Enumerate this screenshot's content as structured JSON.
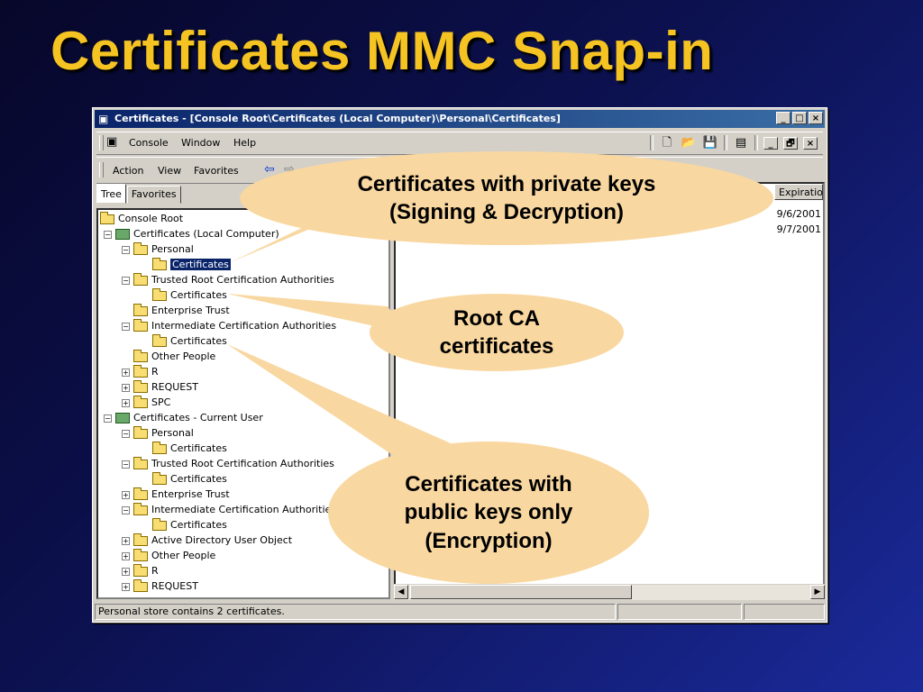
{
  "slide": {
    "title": "Certificates MMC Snap-in"
  },
  "window": {
    "title": "Certificates - [Console Root\\Certificates (Local Computer)\\Personal\\Certificates]",
    "controls": [
      "_",
      "□",
      "×"
    ]
  },
  "menubar": {
    "items": [
      "Console",
      "Window",
      "Help"
    ],
    "mdi_controls": [
      "_",
      "🗗",
      "×"
    ]
  },
  "actionbar": {
    "items": [
      "Action",
      "View",
      "Favorites"
    ]
  },
  "tabs": [
    "Tree",
    "Favorites"
  ],
  "tree": [
    {
      "label": "Console Root"
    },
    {
      "label": "Certificates (Local Computer)"
    },
    {
      "label": "Personal"
    },
    {
      "label": "Certificates"
    },
    {
      "label": "Trusted Root Certification Authorities"
    },
    {
      "label": "Certificates"
    },
    {
      "label": "Enterprise Trust"
    },
    {
      "label": "Intermediate Certification Authorities"
    },
    {
      "label": "Certificates"
    },
    {
      "label": "Other People"
    },
    {
      "label": "R"
    },
    {
      "label": "REQUEST"
    },
    {
      "label": "SPC"
    },
    {
      "label": "Certificates - Current User"
    },
    {
      "label": "Personal"
    },
    {
      "label": "Certificates"
    },
    {
      "label": "Trusted Root Certification Authorities"
    },
    {
      "label": "Certificates"
    },
    {
      "label": "Enterprise Trust"
    },
    {
      "label": "Intermediate Certification Authorities"
    },
    {
      "label": "Certificates"
    },
    {
      "label": "Active Directory User Object"
    },
    {
      "label": "Other People"
    },
    {
      "label": "R"
    },
    {
      "label": "REQUEST"
    }
  ],
  "list": {
    "column": "Expiratio",
    "values": [
      "9/6/2001",
      "9/7/2001"
    ]
  },
  "status": {
    "text": "Personal store contains 2 certificates."
  },
  "callouts": {
    "private": {
      "line1": "Certificates with private keys",
      "line2": "(Signing & Decryption)"
    },
    "root": {
      "line1": "Root CA",
      "line2": "certificates"
    },
    "public": {
      "line1": "Certificates with",
      "line2": "public keys only",
      "line3": "(Encryption)"
    }
  },
  "colors": {
    "title": "#f5c423",
    "callout": "#f9d7a0",
    "titlebar": "#0a246a"
  }
}
